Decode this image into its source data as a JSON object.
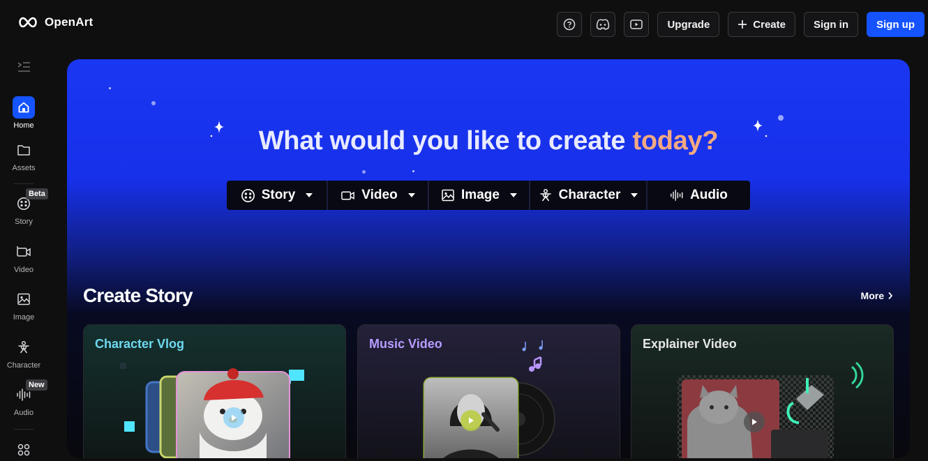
{
  "brand": {
    "name": "OpenArt"
  },
  "topbar": {
    "help_icon": "help-circle-icon",
    "discord_icon": "discord-icon",
    "youtube_icon": "youtube-icon",
    "upgrade_label": "Upgrade",
    "create_label": "Create",
    "signin_label": "Sign in",
    "signup_label": "Sign up"
  },
  "sidebar": {
    "items": [
      {
        "label": "Home",
        "icon": "home-icon"
      },
      {
        "label": "Assets",
        "icon": "folder-icon"
      },
      {
        "label": "Story",
        "icon": "story-icon",
        "badge": "Beta"
      },
      {
        "label": "Video",
        "icon": "video-icon"
      },
      {
        "label": "Image",
        "icon": "image-icon"
      },
      {
        "label": "Character",
        "icon": "character-icon"
      },
      {
        "label": "Audio",
        "icon": "audio-icon",
        "badge": "New"
      },
      {
        "label": "",
        "icon": "apps-icon"
      }
    ]
  },
  "hero": {
    "title_main": "What would you like to create",
    "title_accent": "today?",
    "tabs": [
      {
        "label": "Story",
        "icon": "story-icon"
      },
      {
        "label": "Video",
        "icon": "video-icon"
      },
      {
        "label": "Image",
        "icon": "image-icon"
      },
      {
        "label": "Character",
        "icon": "character-icon"
      },
      {
        "label": "Audio",
        "icon": "audio-icon"
      }
    ]
  },
  "section": {
    "title": "Create Story",
    "more_label": "More",
    "cards": [
      {
        "title": "Character Vlog",
        "color": "#6fd9ef"
      },
      {
        "title": "Music Video",
        "color": "#b79cff"
      },
      {
        "title": "Explainer Video",
        "color": "#e7e7e7"
      }
    ]
  },
  "colors": {
    "primary": "#1553ff",
    "hero_blue": "#1a37f2",
    "accent": "#f3a982"
  }
}
